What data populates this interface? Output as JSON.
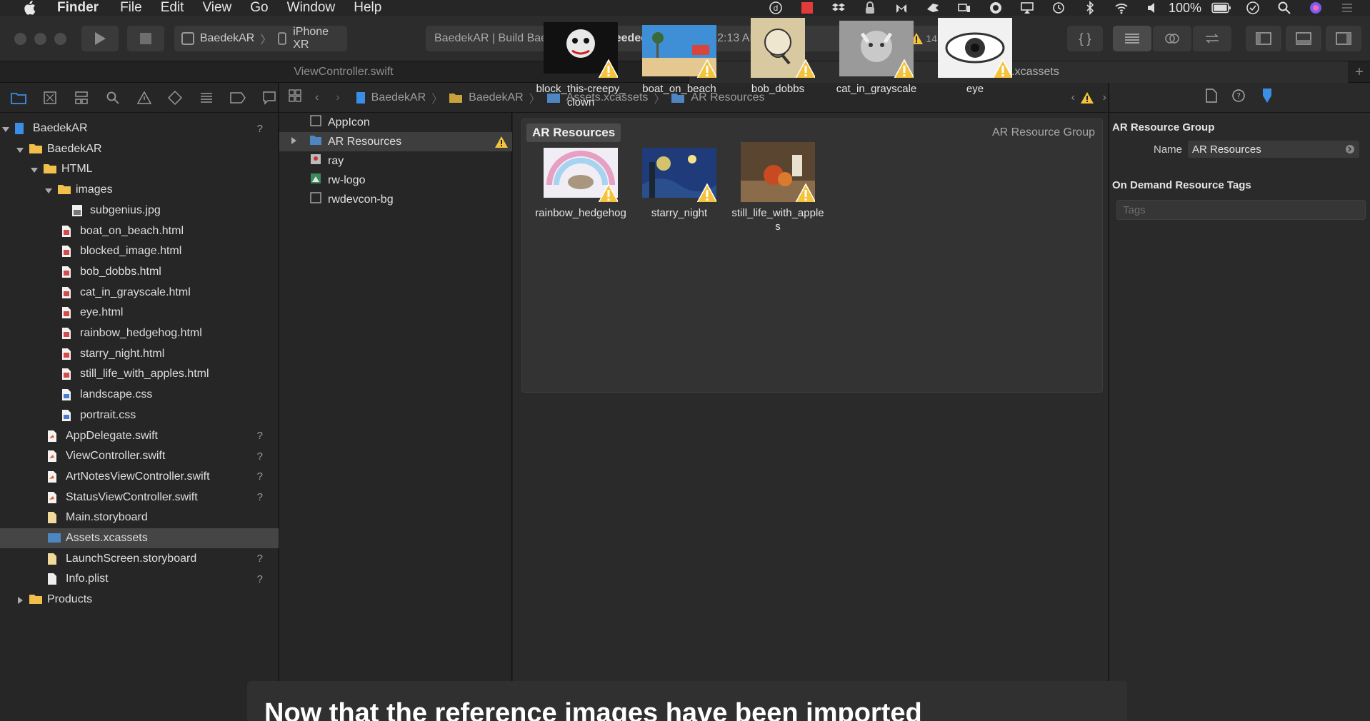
{
  "menubar": {
    "app": "Finder",
    "items": [
      "File",
      "Edit",
      "View",
      "Go",
      "Window",
      "Help"
    ],
    "battery": "100%"
  },
  "toolbar": {
    "scheme_target": "BaedekAR",
    "scheme_device": "iPhone XR",
    "activity_prefix": "BaedekAR | Build BaedekAR:",
    "activity_status": "Succeeded",
    "activity_time": "| 9/30/18 at 12:13 AM",
    "warning_count": "14"
  },
  "tabs": [
    "ViewController.swift",
    "Assets.xcassets"
  ],
  "navigator": {
    "rows": [
      {
        "label": "BaedekAR",
        "kind": "project",
        "q": "?"
      },
      {
        "label": "BaedekAR",
        "kind": "folder"
      },
      {
        "label": "HTML",
        "kind": "folder"
      },
      {
        "label": "images",
        "kind": "folder"
      },
      {
        "label": "subgenius.jpg",
        "kind": "image"
      },
      {
        "label": "boat_on_beach.html",
        "kind": "html"
      },
      {
        "label": "blocked_image.html",
        "kind": "html"
      },
      {
        "label": "bob_dobbs.html",
        "kind": "html"
      },
      {
        "label": "cat_in_grayscale.html",
        "kind": "html"
      },
      {
        "label": "eye.html",
        "kind": "html"
      },
      {
        "label": "rainbow_hedgehog.html",
        "kind": "html"
      },
      {
        "label": "starry_night.html",
        "kind": "html"
      },
      {
        "label": "still_life_with_apples.html",
        "kind": "html"
      },
      {
        "label": "landscape.css",
        "kind": "css"
      },
      {
        "label": "portrait.css",
        "kind": "css"
      },
      {
        "label": "AppDelegate.swift",
        "kind": "swift",
        "q": "?"
      },
      {
        "label": "ViewController.swift",
        "kind": "swift",
        "q": "?"
      },
      {
        "label": "ArtNotesViewController.swift",
        "kind": "swift",
        "q": "?"
      },
      {
        "label": "StatusViewController.swift",
        "kind": "swift",
        "q": "?"
      },
      {
        "label": "Main.storyboard",
        "kind": "storyboard"
      },
      {
        "label": "Assets.xcassets",
        "kind": "assets"
      },
      {
        "label": "LaunchScreen.storyboard",
        "kind": "storyboard",
        "q": "?"
      },
      {
        "label": "Info.plist",
        "kind": "plist",
        "q": "?"
      },
      {
        "label": "Products",
        "kind": "folder"
      }
    ]
  },
  "breadcrumb": [
    "BaedekAR",
    "BaedekAR",
    "Assets.xcassets",
    "AR Resources"
  ],
  "asset_list": [
    "AppIcon",
    "AR Resources",
    "ray",
    "rw-logo",
    "rwdevcon-bg"
  ],
  "group": {
    "title": "AR Resources",
    "kind": "AR Resource Group",
    "assets": [
      "block_this-creepy_clown",
      "boat_on_beach",
      "bob_dobbs",
      "cat_in_grayscale",
      "eye",
      "rainbow_hedgehog",
      "starry_night",
      "still_life_with_apples"
    ]
  },
  "inspector": {
    "section1": "AR Resource Group",
    "name_label": "Name",
    "name_value": "AR Resources",
    "section2": "On Demand Resource Tags",
    "tags_placeholder": "Tags"
  },
  "caption": "Now that the reference images have been imported",
  "colors": {
    "accent_blue": "#3a8ee6",
    "warning": "#f5c33b",
    "folder": "#f1c04a"
  }
}
